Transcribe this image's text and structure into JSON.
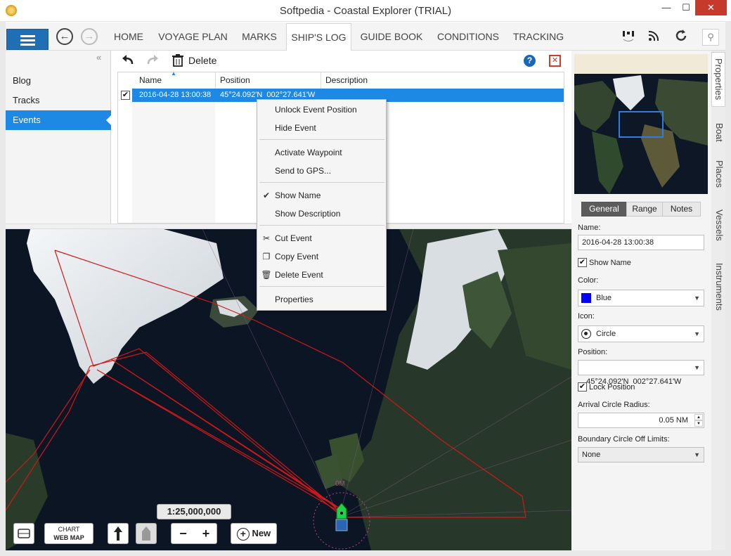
{
  "window": {
    "title": "Softpedia - Coastal Explorer (TRIAL)",
    "minimize": "—",
    "maximize": "☐",
    "close": "✕"
  },
  "nav": {
    "tabs": [
      "HOME",
      "VOYAGE PLAN",
      "MARKS",
      "SHIP'S LOG",
      "GUIDE BOOK",
      "CONDITIONS",
      "TRACKING"
    ],
    "active_tab": "SHIP'S LOG",
    "back_icon": "←",
    "forward_icon": "→"
  },
  "sidebar": {
    "collapse_icon": "«",
    "items": [
      "Blog",
      "Tracks",
      "Events"
    ],
    "active": "Events"
  },
  "toolbar": {
    "delete_label": "Delete",
    "help_icon": "?",
    "close_icon": "✕"
  },
  "table": {
    "columns": [
      "Name",
      "Position",
      "Description"
    ],
    "rows": [
      {
        "checked": true,
        "name": "2016-04-28 13:00:38",
        "position": "45°24.092'N  002°27.641'W",
        "description": ""
      }
    ]
  },
  "context_menu": {
    "items": [
      "Unlock Event Position",
      "Hide Event",
      "Activate Waypoint",
      "Send to GPS...",
      "Show Name",
      "Show Description",
      "Cut Event",
      "Copy Event",
      "Delete Event",
      "Properties"
    ]
  },
  "map": {
    "scale": "1:25,000,000",
    "chart_top": "CHART",
    "chart_bottom": "WEB MAP",
    "zoom_out": "−",
    "zoom_in": "+",
    "new_label": "New"
  },
  "properties": {
    "tabs": [
      "General",
      "Range",
      "Notes"
    ],
    "active_tab": "General",
    "name_label": "Name:",
    "name_value": "2016-04-28 13:00:38",
    "show_name_label": "Show Name",
    "show_name_checked": true,
    "color_label": "Color:",
    "color_value": "Blue",
    "color_swatch": "#0000ff",
    "icon_label": "Icon:",
    "icon_value": "Circle",
    "position_label": "Position:",
    "position_value": "45°24.092'N  002°27.641'W",
    "lock_position_label": "Lock Position",
    "lock_position_checked": true,
    "arrival_label": "Arrival Circle Radius:",
    "arrival_value": "0.05 NM",
    "boundary_label": "Boundary Circle Off Limits:",
    "boundary_value": "None"
  },
  "side_tabs": [
    "Properties",
    "Boat",
    "Places",
    "Vessels",
    "Instruments"
  ],
  "colors": {
    "accent": "#1e88e5",
    "hamburger": "#1f6fb5",
    "close": "#c7392b",
    "route": "#d01818"
  }
}
